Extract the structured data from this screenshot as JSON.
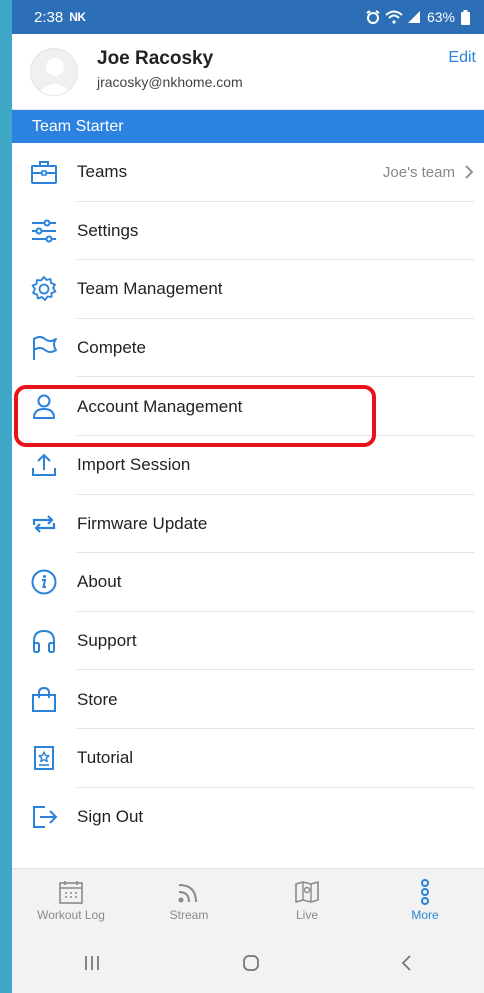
{
  "status": {
    "time": "2:38",
    "carrier": "NK",
    "battery": "63%"
  },
  "profile": {
    "name": "Joe Racosky",
    "email": "jracosky@nkhome.com",
    "edit_label": "Edit"
  },
  "team_banner": "Team Starter",
  "menu": [
    {
      "label": "Teams",
      "icon": "briefcase-icon",
      "aux": "Joe's team"
    },
    {
      "label": "Settings",
      "icon": "sliders-icon"
    },
    {
      "label": "Team Management",
      "icon": "gear-icon"
    },
    {
      "label": "Compete",
      "icon": "flag-icon"
    },
    {
      "label": "Account Management",
      "icon": "person-icon"
    },
    {
      "label": "Import Session",
      "icon": "upload-icon"
    },
    {
      "label": "Firmware Update",
      "icon": "sync-icon"
    },
    {
      "label": "About",
      "icon": "info-icon"
    },
    {
      "label": "Support",
      "icon": "headphones-icon"
    },
    {
      "label": "Store",
      "icon": "shopping-bag-icon"
    },
    {
      "label": "Tutorial",
      "icon": "tutorial-book-icon"
    },
    {
      "label": "Sign Out",
      "icon": "sign-out-icon"
    }
  ],
  "tabs": [
    {
      "label": "Workout Log",
      "icon": "calendar-icon"
    },
    {
      "label": "Stream",
      "icon": "stream-icon"
    },
    {
      "label": "Live",
      "icon": "map-icon"
    },
    {
      "label": "More",
      "icon": "more-dots-icon",
      "active": true
    }
  ],
  "colors": {
    "accent": "#2b82d9",
    "status_bar": "#2d6fb7",
    "banner": "#2b82e0",
    "highlight": "#e8131a"
  }
}
